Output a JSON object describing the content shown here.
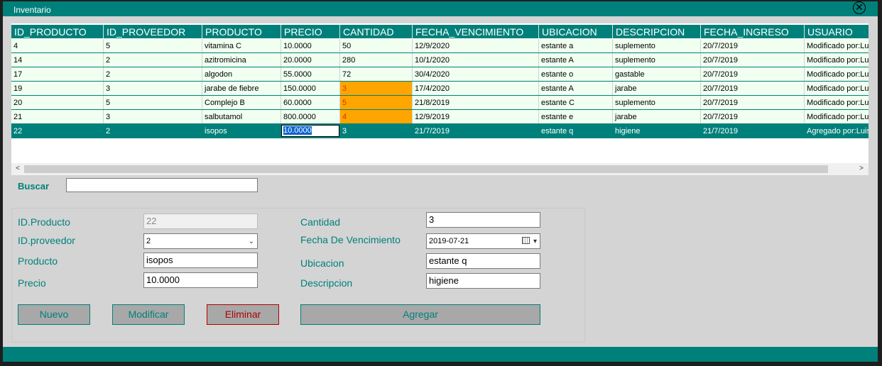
{
  "window": {
    "title": "Inventario"
  },
  "grid": {
    "columns": [
      "ID_PRODUCTO",
      "ID_PROVEEDOR",
      "PRODUCTO",
      "PRECIO",
      "CANTIDAD",
      "FECHA_VENCIMIENTO",
      "UBICACION",
      "DESCRIPCION",
      "FECHA_INGRESO",
      "USUARIO"
    ],
    "rows": [
      [
        "4",
        "5",
        "vitamina C",
        "10.0000",
        "50",
        "12/9/2020",
        "estante a",
        "suplemento",
        "20/7/2019",
        "Modificado por:Luis"
      ],
      [
        "14",
        "2",
        "azitromicina",
        "20.0000",
        "280",
        "10/1/2020",
        "estante A",
        "suplemento",
        "20/7/2019",
        "Modificado por:Luis"
      ],
      [
        "17",
        "2",
        "algodon",
        "55.0000",
        "72",
        "30/4/2020",
        "estante o",
        "gastable",
        "20/7/2019",
        "Modificado por:Luis"
      ],
      [
        "19",
        "3",
        "jarabe de fiebre",
        "150.0000",
        "3",
        "17/4/2020",
        "estante A",
        "jarabe",
        "20/7/2019",
        "Modificado por:Luis"
      ],
      [
        "20",
        "5",
        "Complejo B",
        "60.0000",
        "5",
        "21/8/2019",
        "estante C",
        "suplemento",
        "20/7/2019",
        "Modificado por:Luis"
      ],
      [
        "21",
        "3",
        "salbutamol",
        "800.0000",
        "4",
        "12/9/2019",
        "estante e",
        "jarabe",
        "20/7/2019",
        "Modificado por:Luis"
      ],
      [
        "22",
        "2",
        "isopos",
        "10.0000",
        "3",
        "21/7/2019",
        "estante q",
        "higiene",
        "21/7/2019",
        "Agregado por:Luis"
      ]
    ],
    "low_stock_rows": [
      3,
      4,
      5
    ],
    "selected_row": 6,
    "low_stock_color": "#ffa500",
    "accent_color": "#00807a"
  },
  "search": {
    "label": "Buscar",
    "value": ""
  },
  "form": {
    "id_producto_label": "ID.Producto",
    "id_producto_value": "22",
    "id_proveedor_label": "ID.proveedor",
    "id_proveedor_value": "2",
    "producto_label": "Producto",
    "producto_value": "isopos",
    "precio_label": "Precio",
    "precio_value": "10.0000",
    "cantidad_label": "Cantidad",
    "cantidad_value": "3",
    "fecha_label": "Fecha De Vencimiento",
    "fecha_value": "2019-07-21",
    "ubicacion_label": "Ubicacion",
    "ubicacion_value": "estante q",
    "descripcion_label": "Descripcion",
    "descripcion_value": "higiene"
  },
  "buttons": {
    "nuevo": "Nuevo",
    "modificar": "Modificar",
    "eliminar": "Eliminar",
    "agregar": "Agregar"
  },
  "icons": {
    "close": "close-icon",
    "dropdown": "chevron-down-icon",
    "calendar": "calendar-icon",
    "scroll_left": "chevron-left-icon",
    "scroll_right": "chevron-right-icon"
  }
}
